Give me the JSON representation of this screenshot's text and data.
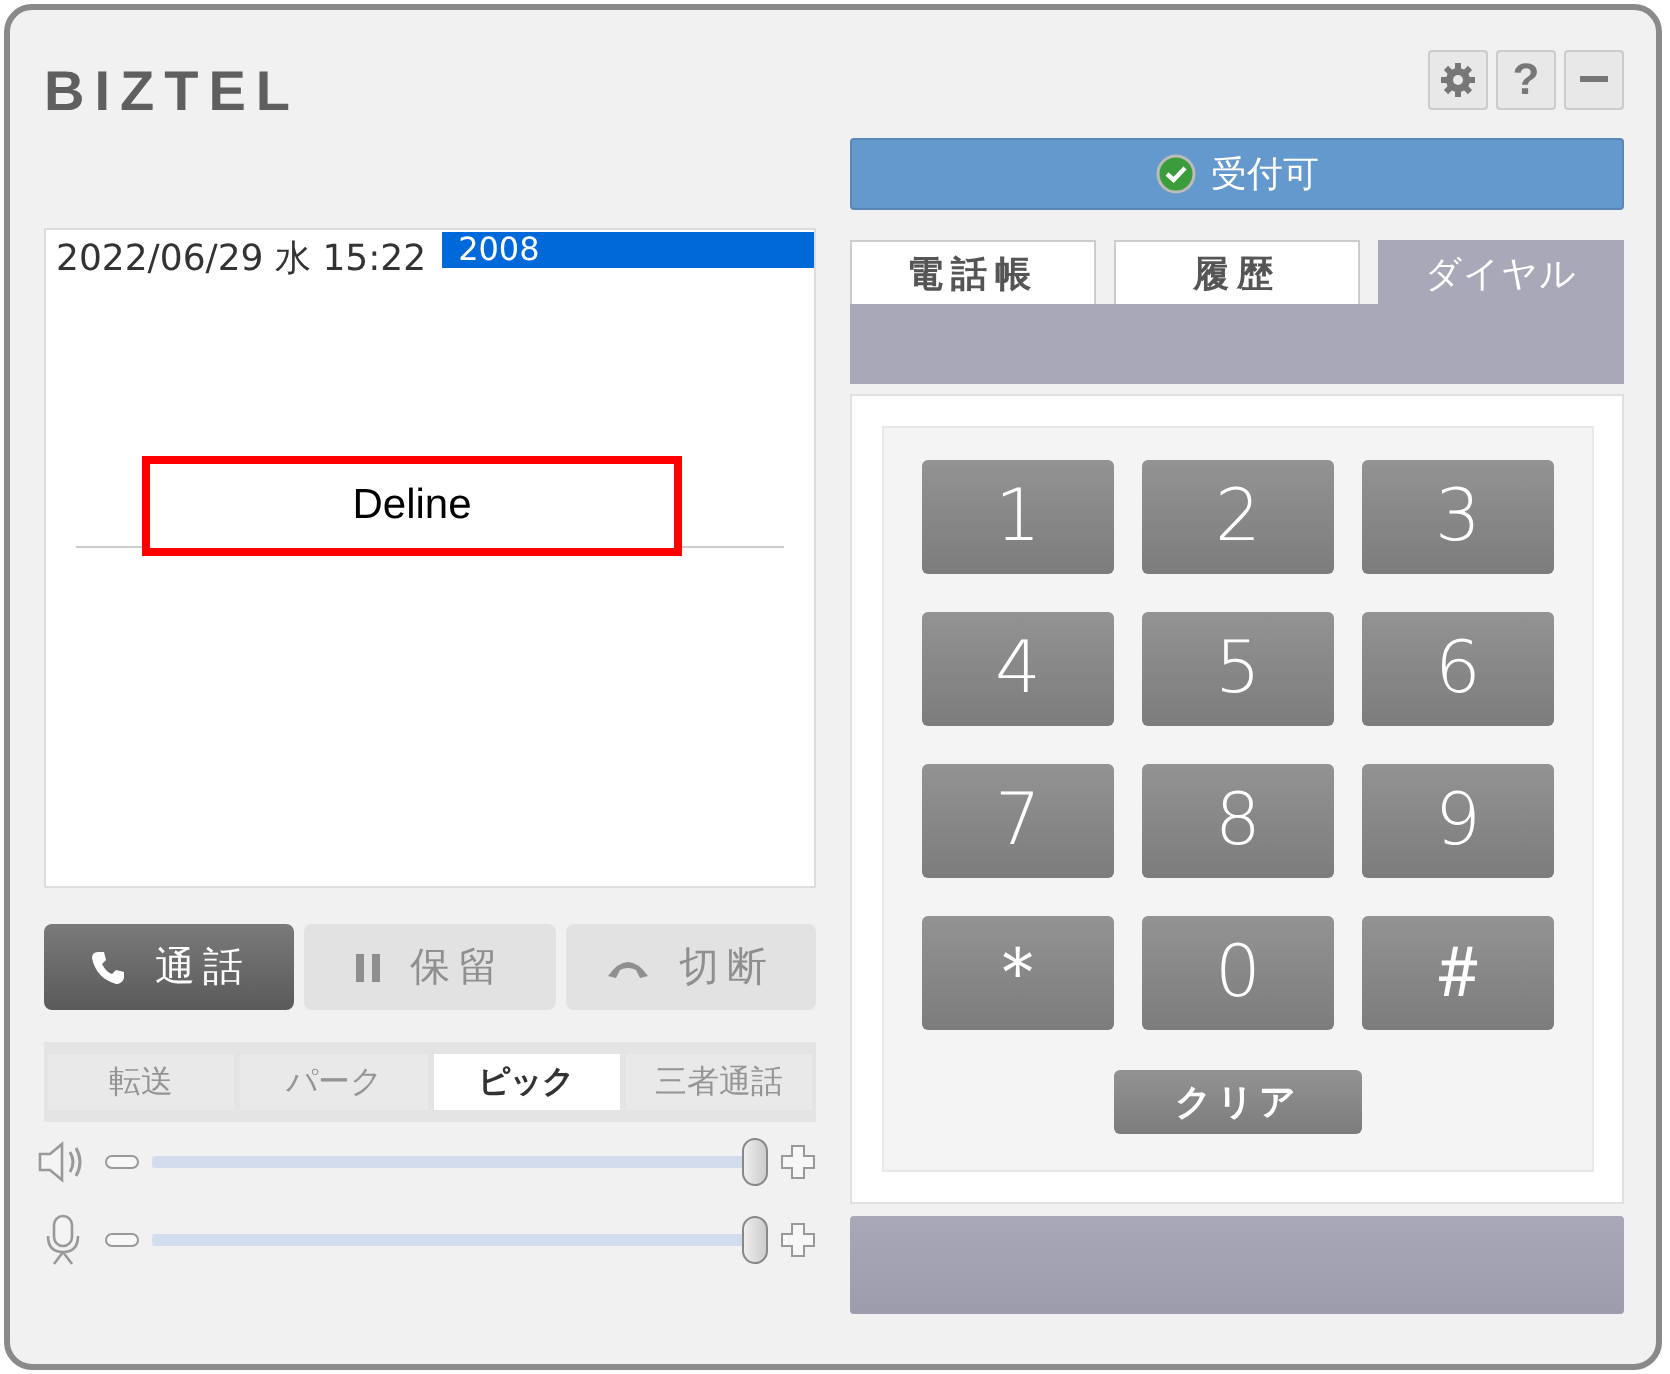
{
  "logo": "BIZTEL",
  "window_buttons": [
    {
      "kind": "settings"
    },
    {
      "kind": "help",
      "label": "?"
    },
    {
      "kind": "minimize"
    }
  ],
  "status": {
    "label": "受付可"
  },
  "call_log": {
    "timestamp": "2022/06/29 水 15:22",
    "number": "2008",
    "callout": "Deline"
  },
  "call_buttons": [
    {
      "kind": "call",
      "label": "通話",
      "disabled": false
    },
    {
      "kind": "hold",
      "label": "保留",
      "disabled": true
    },
    {
      "kind": "hangup",
      "label": "切断",
      "disabled": true
    }
  ],
  "function_tabs": [
    {
      "label": "転送",
      "selected": false
    },
    {
      "label": "パーク",
      "selected": false
    },
    {
      "label": "ピック",
      "selected": true
    },
    {
      "label": "三者通話",
      "selected": false
    }
  ],
  "volume_sliders": [
    {
      "kind": "speaker",
      "level": 1.0
    },
    {
      "kind": "microphone",
      "level": 1.0
    }
  ],
  "tabs": [
    {
      "label": "電話帳",
      "selected": false
    },
    {
      "label": "履歴",
      "selected": false
    },
    {
      "label": "ダイヤル",
      "selected": true
    }
  ],
  "keypad": [
    "1",
    "2",
    "3",
    "4",
    "5",
    "6",
    "7",
    "8",
    "9",
    "＊",
    "0",
    "＃"
  ],
  "clear_button": "クリア"
}
